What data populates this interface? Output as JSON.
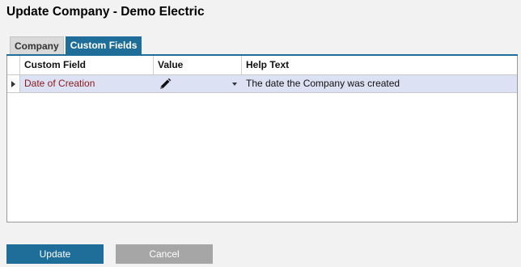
{
  "dialog": {
    "title": "Update Company - Demo Electric"
  },
  "tabs": [
    {
      "label": "Company",
      "active": false
    },
    {
      "label": "Custom Fields",
      "active": true
    }
  ],
  "grid": {
    "columns": [
      "Custom Field",
      "Value",
      "Help Text"
    ],
    "rows": [
      {
        "field": "Date of Creation",
        "value_icon": "pencil-icon",
        "help": "The date the Company was created"
      }
    ]
  },
  "buttons": {
    "update_label": "Update",
    "cancel_label": "Cancel"
  },
  "colors": {
    "accent": "#1f6e99",
    "row_selected": "#dde1f4",
    "field_text": "#8b1a1a",
    "cancel": "#a6a6a6"
  }
}
